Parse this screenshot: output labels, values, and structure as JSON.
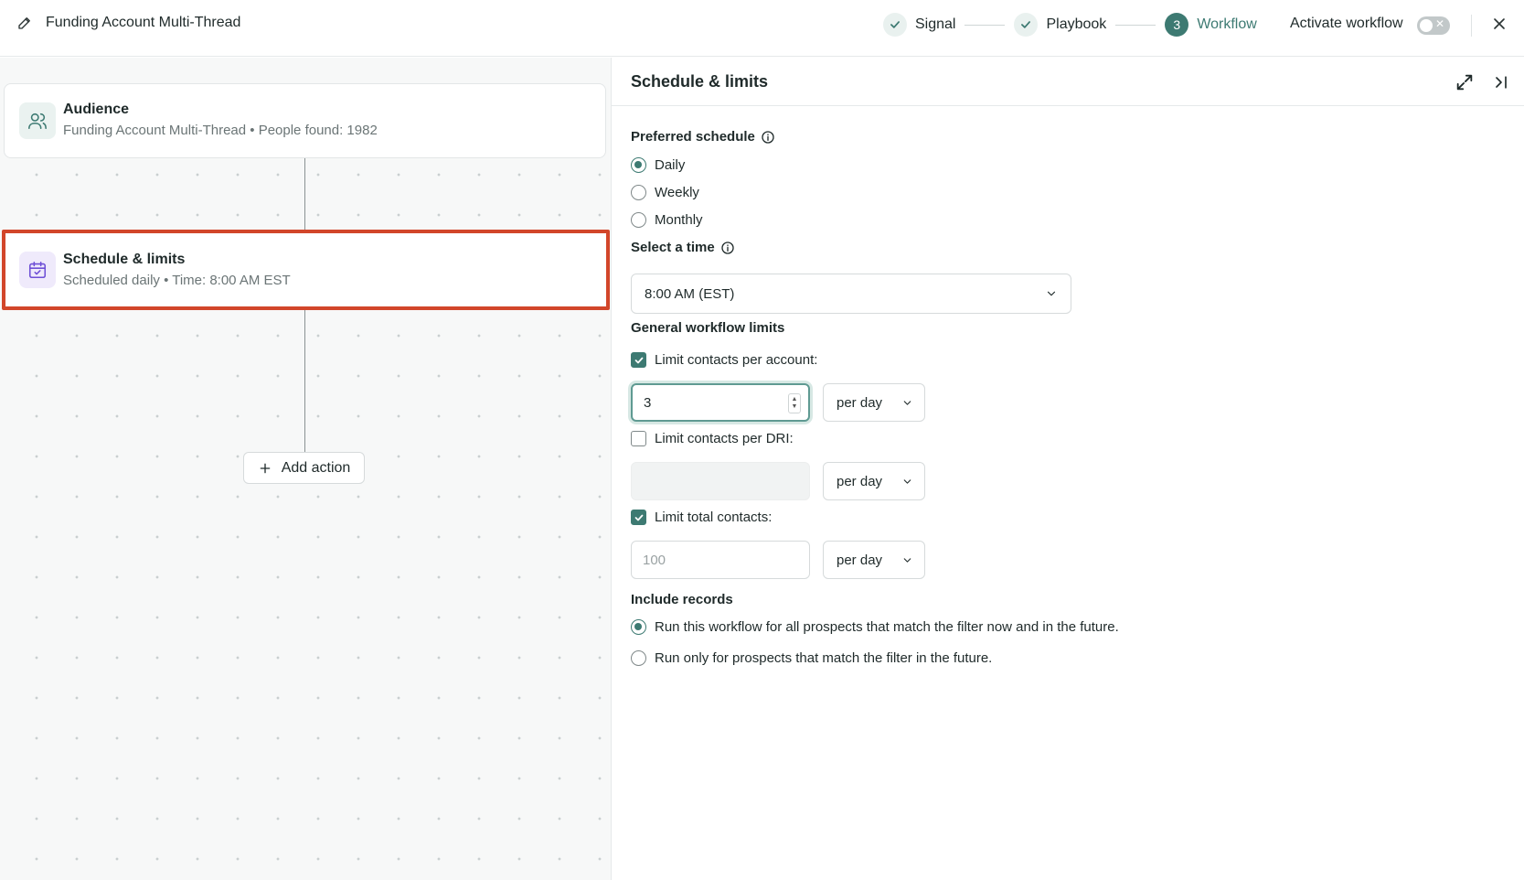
{
  "header": {
    "title": "Funding Account Multi-Thread",
    "steps": [
      {
        "label": "Signal",
        "state": "done"
      },
      {
        "label": "Playbook",
        "state": "done"
      },
      {
        "label": "Workflow",
        "state": "current",
        "number": "3"
      }
    ],
    "activate_label": "Activate workflow",
    "activate_on": false,
    "accent_color": "#3d7a72"
  },
  "canvas": {
    "audience": {
      "title": "Audience",
      "subtitle": "Funding Account Multi-Thread • People found: 1982"
    },
    "schedule": {
      "title": "Schedule & limits",
      "subtitle": "Scheduled daily • Time: 8:00 AM EST"
    },
    "add_action_label": "Add action",
    "highlight_color": "#d2462a"
  },
  "panel": {
    "title": "Schedule & limits",
    "preferred_schedule": {
      "label": "Preferred schedule",
      "options": [
        {
          "label": "Daily",
          "selected": true
        },
        {
          "label": "Weekly",
          "selected": false
        },
        {
          "label": "Monthly",
          "selected": false
        }
      ]
    },
    "select_time": {
      "label": "Select a time",
      "value": "8:00 AM (EST)"
    },
    "limits": {
      "label": "General workflow limits",
      "per_account": {
        "label": "Limit contacts per account:",
        "checked": true,
        "value": "3",
        "period": "per day"
      },
      "per_dri": {
        "label": "Limit contacts per DRI:",
        "checked": false,
        "value": "",
        "period": "per day"
      },
      "total": {
        "label": "Limit total contacts:",
        "checked": true,
        "placeholder": "100",
        "period": "per day"
      }
    },
    "include_records": {
      "label": "Include records",
      "options": [
        {
          "label": "Run this workflow for all prospects that match the filter now and in the future.",
          "selected": true
        },
        {
          "label": "Run only for prospects that match the filter in the future.",
          "selected": false
        }
      ]
    }
  }
}
